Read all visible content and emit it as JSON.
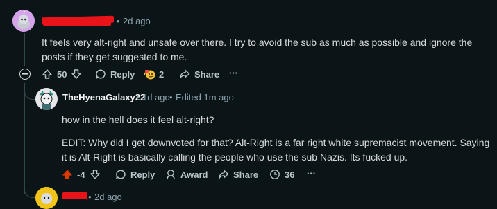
{
  "comment1": {
    "age": "2d ago",
    "text": "It feels very alt-right and unsafe over there. I try to avoid the sub as much as possible and ignore the posts if they get suggested to me.",
    "score": "50",
    "reply_label": "Reply",
    "award_count": "2",
    "share_label": "Share",
    "more_label": "···"
  },
  "comment2": {
    "author": "TheHyenaGalaxy22",
    "age": "1d ago",
    "edited": "Edited 1m ago",
    "text1": "how in the hell does it feel alt-right?",
    "text2": "EDIT: Why did I get downvoted for that? Alt-Right is a far right white supremacist movement. Saying it is Alt-Right is basically calling the people who use the sub Nazis. Its fucked up.",
    "score": "-4",
    "reply_label": "Reply",
    "award_label": "Award",
    "share_label": "Share",
    "views": "36",
    "more_label": "···"
  },
  "comment3": {
    "age": "2d ago"
  },
  "colors": {
    "background": "#0b1416",
    "upvote_active": "#ff4500",
    "redaction": "#e8141a"
  }
}
